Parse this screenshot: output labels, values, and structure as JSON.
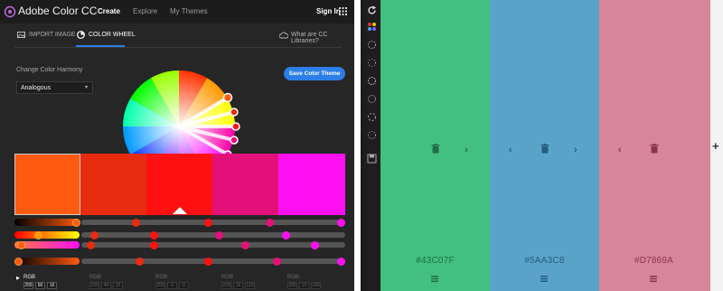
{
  "app": {
    "title": "Adobe Color CC",
    "nav": [
      "Create",
      "Explore",
      "My Themes"
    ],
    "active_nav": "Create",
    "signin": "Sign In"
  },
  "subtabs": {
    "import_image": "IMPORT IMAGE",
    "color_wheel": "COLOR WHEEL",
    "libraries": "What are CC Libraries?"
  },
  "harmony": {
    "label": "Change Color Harmony",
    "value": "Analogous"
  },
  "save_button": "Save Color Theme",
  "theme_swatches": [
    {
      "color": "#ff5a10"
    },
    {
      "color": "#e82c0f"
    },
    {
      "color": "#ff1111"
    },
    {
      "color": "#e4107a"
    },
    {
      "color": "#ff10f0"
    }
  ],
  "rgb": {
    "label": "RGB",
    "selected_values": [
      "255",
      "90",
      "16"
    ],
    "other_values": [
      [
        "230",
        "44",
        "15"
      ],
      [
        "255",
        "0",
        "0"
      ],
      [
        "228",
        "16",
        "122"
      ],
      [
        "255",
        "16",
        "240"
      ]
    ]
  },
  "palette": [
    {
      "hex": "#43C07F",
      "color": "#43c07f",
      "fg": "#1e6e45"
    },
    {
      "hex": "#5AA3C8",
      "color": "#5aa3c8",
      "fg": "#245d7f"
    },
    {
      "hex": "#D7869A",
      "color": "#d7869a",
      "fg": "#8a3549"
    }
  ],
  "add_column_icon": "plus-icon"
}
